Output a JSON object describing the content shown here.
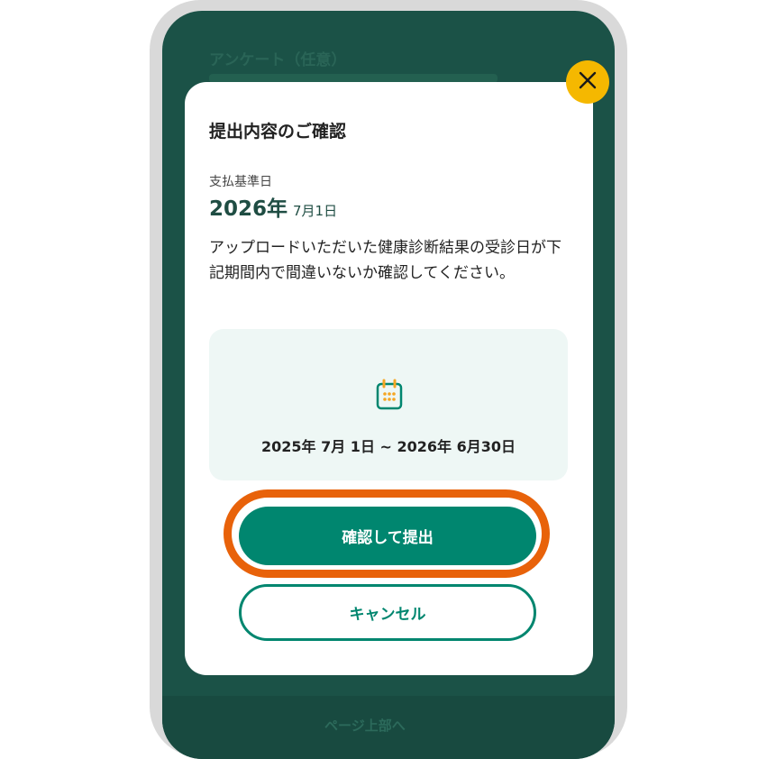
{
  "modal": {
    "title": "提出内容のご確認",
    "payment_base_date_label": "支払基準日",
    "payment_base_date_year": "2026年",
    "payment_base_date_monthday": "7月1日",
    "instruction": "アップロードいただいた健康診断結果の受診日が下記期間内で間違いないか確認してください。",
    "period_icon": "calendar-icon",
    "period": "2025年 7月 1日 ~ 2026年 6月30日",
    "confirm_label": "確認して提出",
    "cancel_label": "キャンセル",
    "close_icon": "close-icon"
  },
  "background": {
    "title": "アンケート（任意）",
    "next_label": "ページ上部へ"
  },
  "colors": {
    "primary": "#00866f",
    "highlight": "#e8620a",
    "close_bg": "#f5b800",
    "overlay": "#1b5247",
    "period_bg": "#eef7f5",
    "calendar_accent": "#f5a623"
  }
}
